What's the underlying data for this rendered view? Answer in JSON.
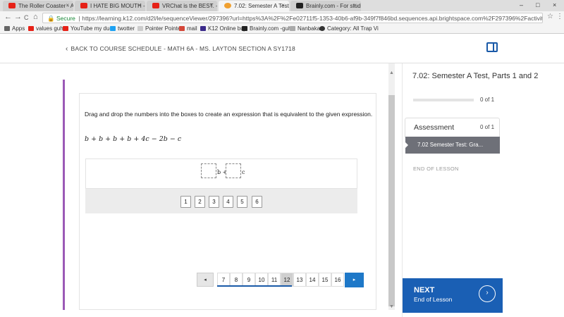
{
  "browser": {
    "tabs": [
      {
        "label": "The Roller Coaster - AVE",
        "color": "#e62117"
      },
      {
        "label": "I HATE BIG MOUTH - Yo",
        "color": "#e62117"
      },
      {
        "label": "VRChat is the BEST. - Yo",
        "color": "#e62117"
      },
      {
        "label": "7.02: Semester A Test, Pa",
        "color": "#f0a030"
      },
      {
        "label": "Brainly.com - For studen",
        "color": "#222222"
      }
    ],
    "window_controls": [
      "–",
      "□",
      "×"
    ],
    "nav": {
      "back": "←",
      "forward": "→",
      "reload": "C",
      "home": "⌂"
    },
    "address": {
      "secure_label": "Secure",
      "url": "https://learning.k12.com/d2l/le/sequenceViewer/297396?url=https%3A%2F%2Fe02711f5-1353-40b6-af9b-349f7f846bd.sequences.api.brightspace.com%2F297396%2Factivity%2F47142098&noMen...",
      "star": "☆"
    },
    "bookmarks": [
      {
        "label": "Apps",
        "color": "#666666"
      },
      {
        "label": "values guh",
        "color": "#e62117"
      },
      {
        "label": "YouTube my dude",
        "color": "#e62117"
      },
      {
        "label": "twotter",
        "color": "#1da1f2"
      },
      {
        "label": "Pointer Pointer",
        "color": "#cccccc"
      },
      {
        "label": "mail",
        "color": "#d44638"
      },
      {
        "label": "K12 Online buj",
        "color": "#3b2a8a"
      },
      {
        "label": "Brainly.com -guh",
        "color": "#222222"
      },
      {
        "label": "Nanbaka",
        "color": "#aaaaaa"
      },
      {
        "label": "Category: All Trap Vi",
        "color": "#333333"
      }
    ]
  },
  "header": {
    "back_link": "BACK TO COURSE SCHEDULE - MATH 6A - MS. LAYTON SECTION A SY1718"
  },
  "question": {
    "prompt": "Drag and drop the numbers into the boxes to create an expression that is equivalent to the given expression.",
    "expression": "b + b + b + b + 4c − 2b − c",
    "drop_labels": [
      "b +",
      "c"
    ],
    "tiles": [
      "1",
      "2",
      "3",
      "4",
      "5",
      "6"
    ]
  },
  "pagination": {
    "prev": "◂",
    "next": "▸",
    "pages": [
      "7",
      "8",
      "9",
      "10",
      "11",
      "12",
      "13",
      "14",
      "15",
      "16"
    ],
    "current": "12"
  },
  "sidebar": {
    "title": "7.02: Semester A Test, Parts 1 and 2",
    "progress_text": "0 of 1",
    "progress_fraction": 0,
    "assessment_label": "Assessment",
    "assessment_count": "0 of 1",
    "active_item": "7.02 Semester Test: Gra...",
    "end_of_lesson": "END OF LESSON",
    "next_title": "NEXT",
    "next_sub": "End of Lesson",
    "accent": "#1a5fb4"
  }
}
